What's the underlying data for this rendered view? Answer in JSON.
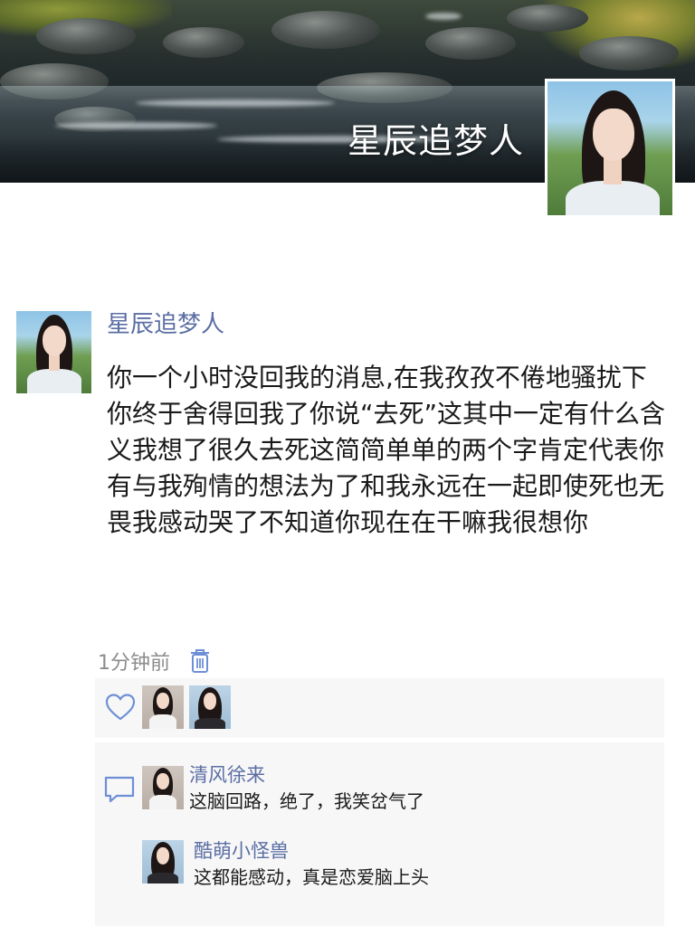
{
  "cover": {
    "title": "星辰追梦人"
  },
  "post": {
    "author": "星辰追梦人",
    "text": "你一个小时没回我的消息,在我孜孜不倦地骚扰下你终于舍得回我了你说“去死”这其中一定有什么含义我想了很久去死这简简单单的两个字肯定代表你有与我殉情的想法为了和我永远在一起即使死也无畏我感动哭了不知道你现在在干嘛我很想你",
    "time": "1分钟前"
  },
  "likes": {
    "icon": "heart-outline-icon",
    "avatars": [
      "avatar-studio",
      "avatar-blue"
    ]
  },
  "comments": [
    {
      "name": "清风徐来",
      "text": "这脑回路，绝了，我笑岔气了",
      "avatar": "avatar-studio"
    },
    {
      "name": "酷萌小怪兽",
      "text": "这都能感动，真是恋爱脑上头",
      "avatar": "avatar-blue"
    }
  ],
  "colors": {
    "name_link": "#5b6ea4",
    "meta_gray": "#8c8c8c",
    "panel_bg": "#f7f7f7",
    "icon_blue": "#6e8fd6"
  }
}
